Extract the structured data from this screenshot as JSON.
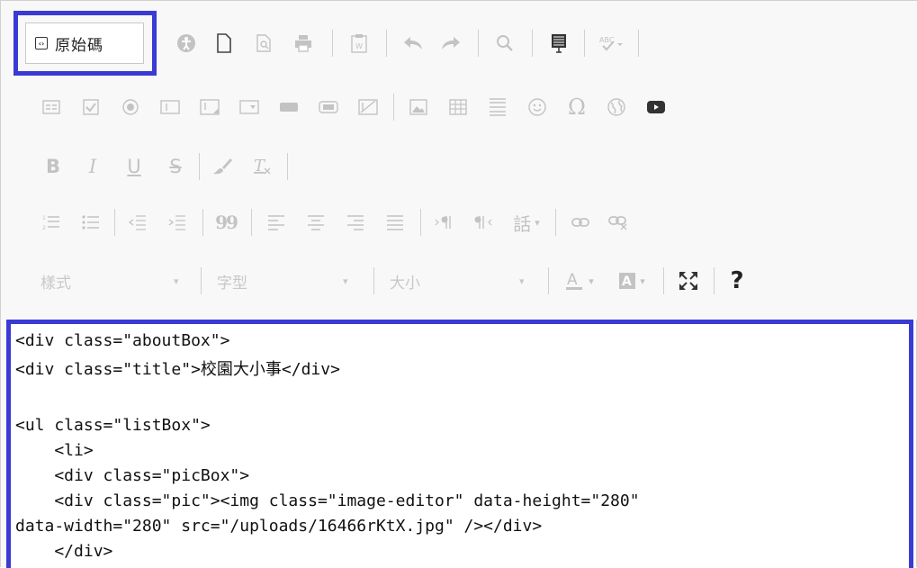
{
  "toolbar": {
    "source_button_label": "原始碼",
    "source_icon_glyph": "‹›",
    "font_style_combo": "樣式",
    "font_family_combo": "字型",
    "font_size_combo": "大小",
    "combo_arrow": "▾",
    "bold_glyph": "B",
    "italic_glyph": "I",
    "underline_glyph": "U",
    "strike_glyph": "S",
    "quote_glyph": "99",
    "special_char_glyph": "Ω",
    "help_glyph": "?",
    "language_glyph": "話",
    "icon_color": "#c3c3c3",
    "highlight_color": "#3a3ad4"
  },
  "source": {
    "lines": [
      "<div class=\"aboutBox\">",
      "<div class=\"title\">校園大小事</div>",
      "",
      "<ul class=\"listBox\">",
      "    <li>",
      "    <div class=\"picBox\">",
      "    <div class=\"pic\"><img class=\"image-editor\" data-height=\"280\"",
      "data-width=\"280\" src=\"/uploads/16466rKtX.jpg\" /></div>",
      "    </div>"
    ]
  }
}
